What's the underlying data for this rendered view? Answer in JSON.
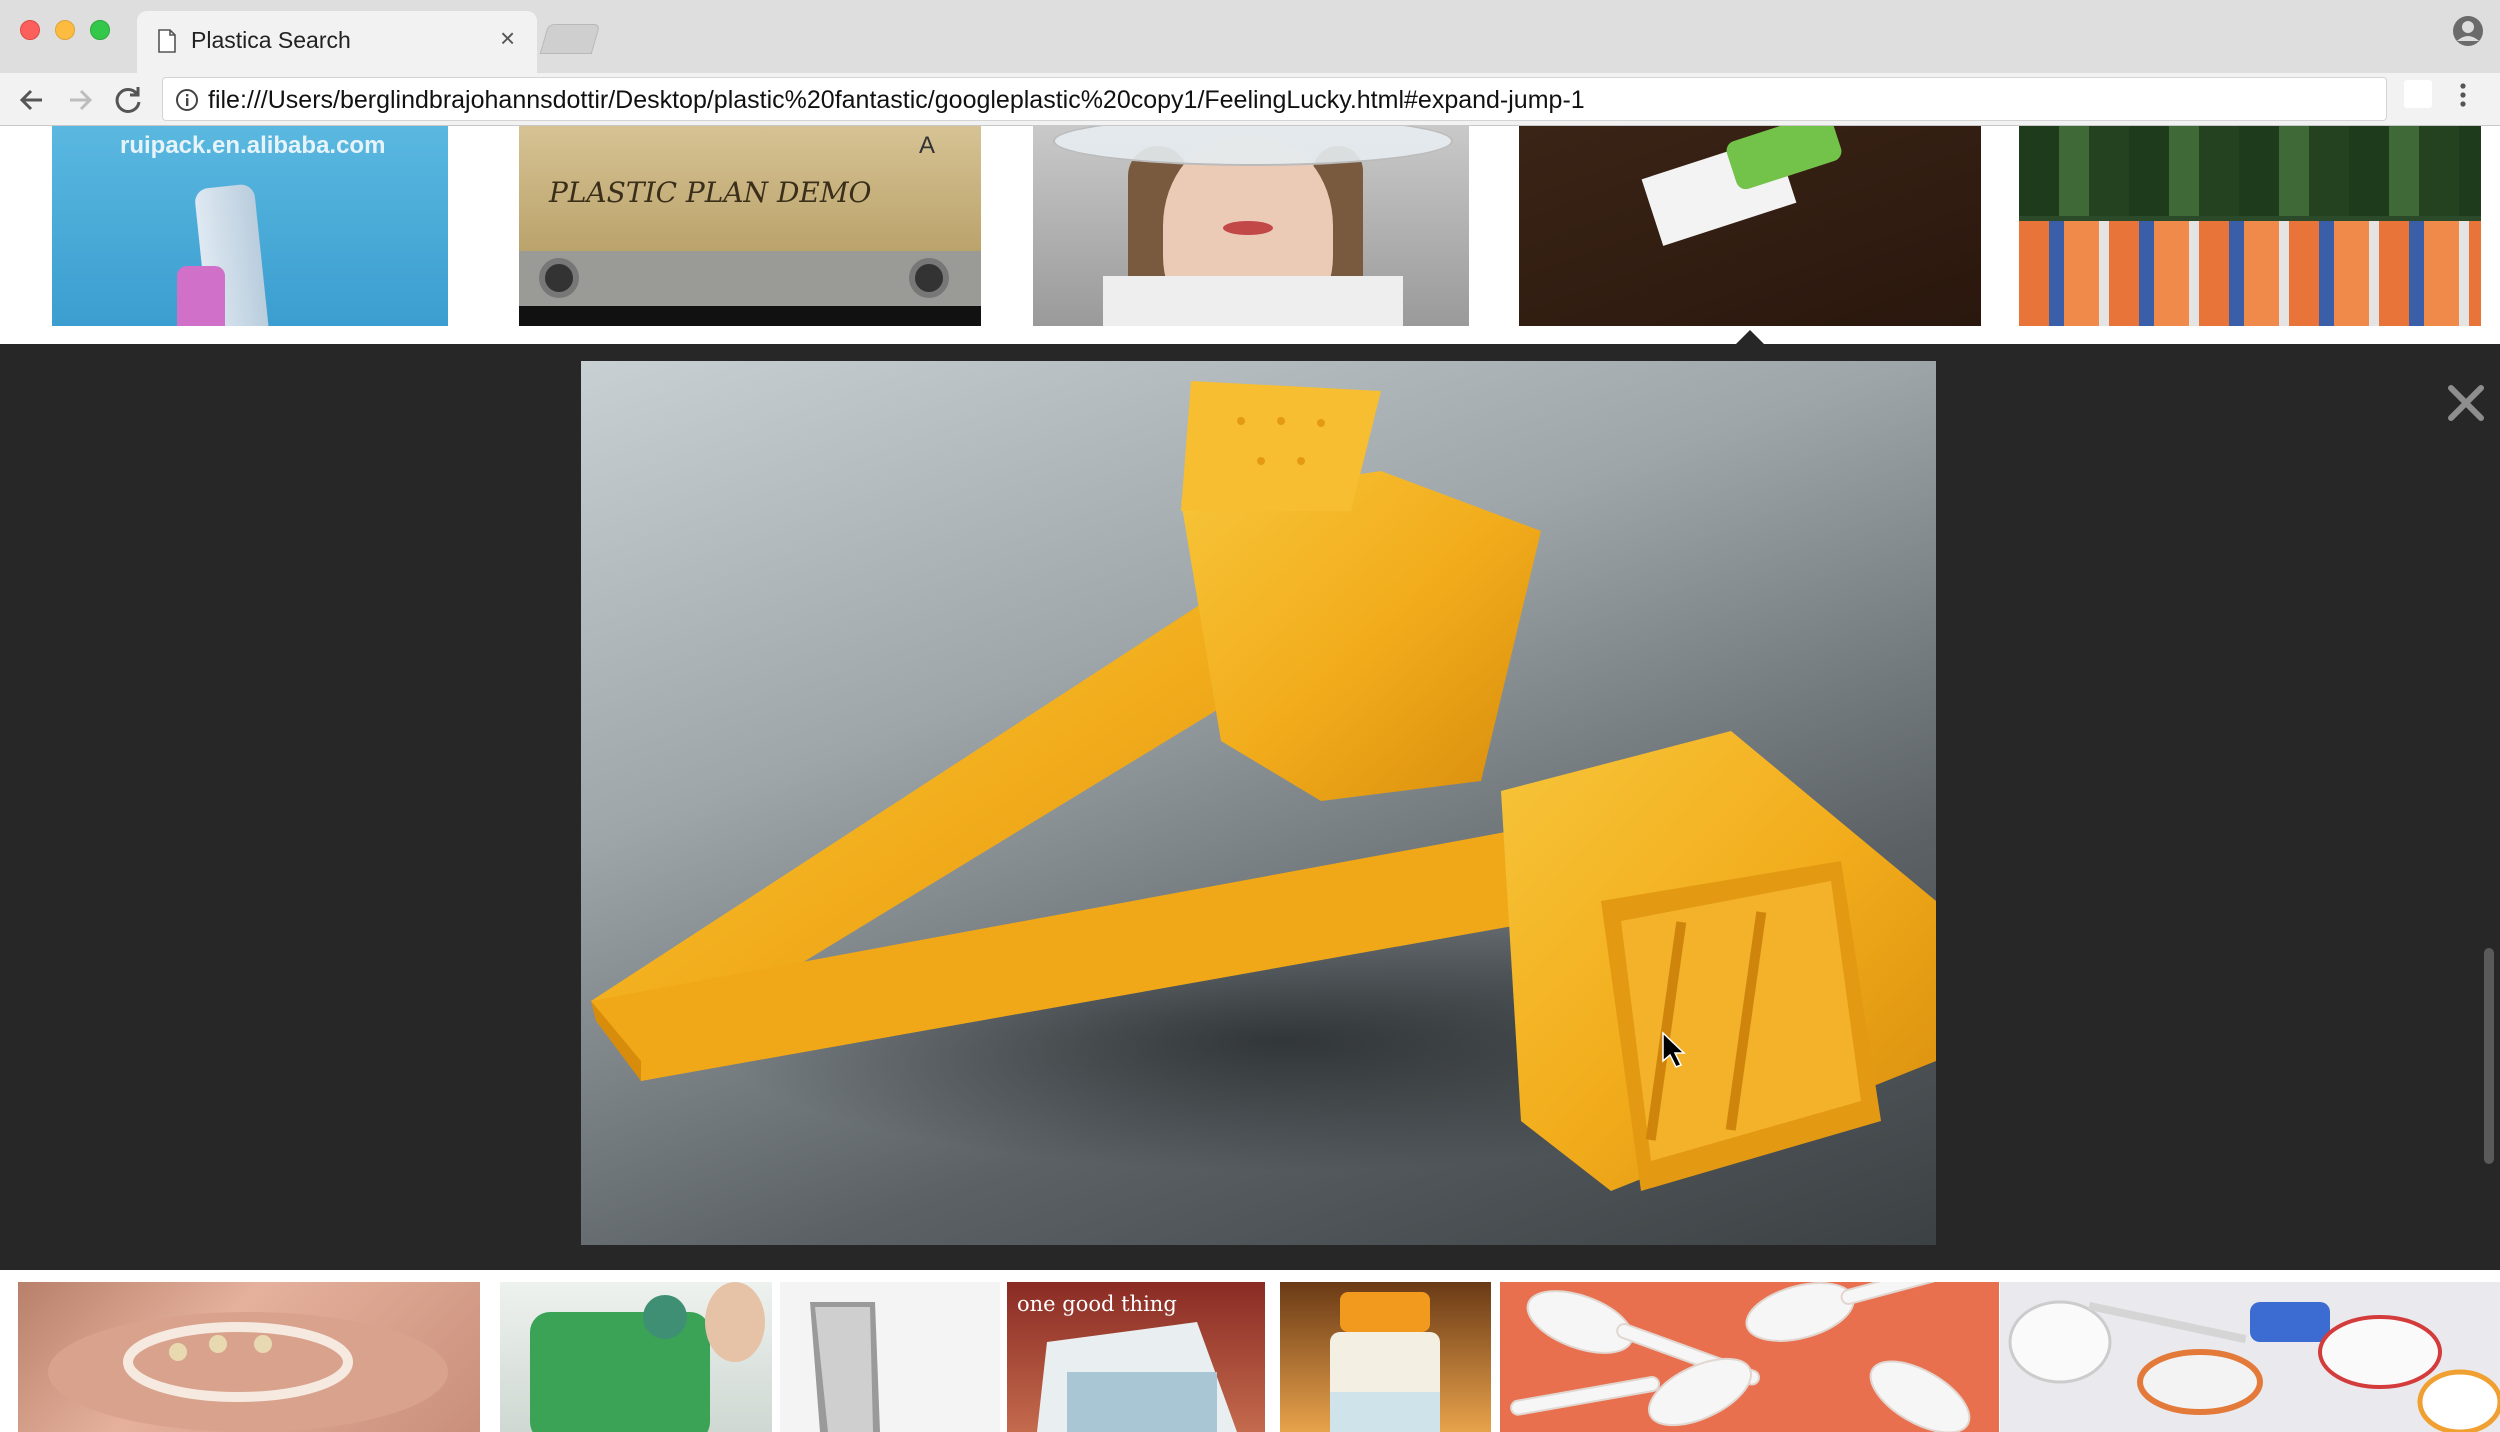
{
  "browser": {
    "tab_title": "Plastica Search",
    "tab_close": "×",
    "url": "file:///Users/berglindbrajohannsdottir/Desktop/plastic%20fantastic/googleplastic%20copy1/FeelingLucky.html#expand-jump-1"
  },
  "results_top": {
    "thumb1_watermark": "ruipack.en.alibaba.com",
    "thumb2_scrawl": "PLASTIC PLAN DEMO",
    "thumb2_side": "A"
  },
  "strip": {
    "thumb4_logo": "one good thing"
  },
  "colors": {
    "preview_bg": "#272727",
    "object_yellow": "#f5b31f",
    "chrome_bg": "#dedede"
  }
}
